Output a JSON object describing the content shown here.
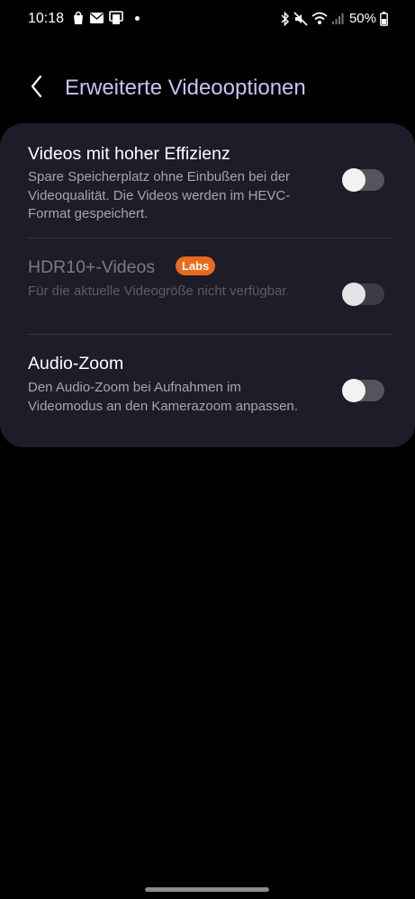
{
  "status_bar": {
    "time": "10:18",
    "battery": "50%",
    "left_icons": [
      "shopping-bag-icon",
      "mail-icon",
      "cast-icon",
      "dot-icon"
    ],
    "right_icons": [
      "bluetooth-icon",
      "mute-icon",
      "wifi-icon",
      "signal-icon",
      "battery-icon"
    ]
  },
  "header": {
    "title": "Erweiterte Videooptionen",
    "back_icon": "chevron-left-icon",
    "title_color": "#c7c4f6"
  },
  "settings": [
    {
      "title": "Videos mit hoher Effizienz",
      "description": "Spare Speicherplatz ohne Einbußen bei der Videoqualität. Die Videos werden im HEVC-Format gespeichert.",
      "enabled": true,
      "toggle_on": false
    },
    {
      "title": "HDR10+-Videos",
      "badge": "Labs",
      "description": "Für die aktuelle Videogröße nicht verfügbar.",
      "enabled": false,
      "toggle_on": false
    },
    {
      "title": "Audio-Zoom",
      "description": "Den Audio-Zoom bei Aufnahmen im Videomodus an den Kamerazoom anpassen.",
      "enabled": true,
      "toggle_on": false
    }
  ],
  "colors": {
    "background": "#000000",
    "card": "#1d1c28",
    "badge": "#e96a1c"
  }
}
